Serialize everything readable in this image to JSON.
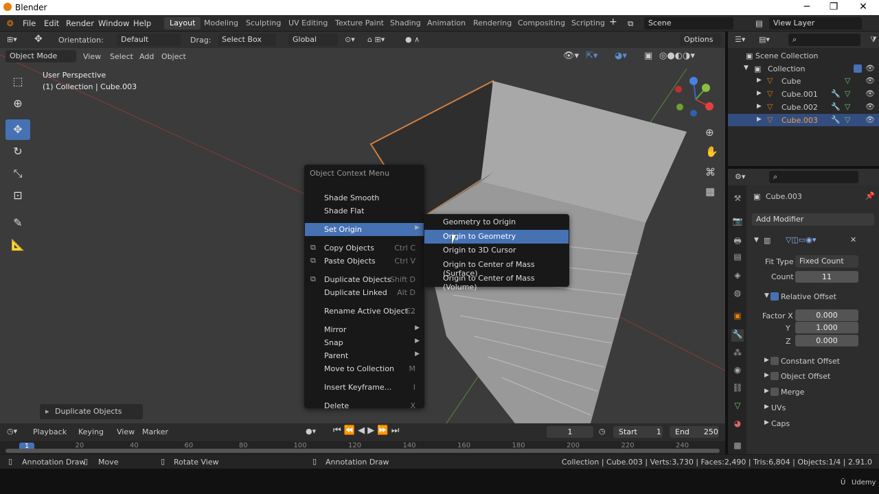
{
  "titlebar": {
    "title": "Blender",
    "min": "─",
    "max": "❐",
    "close": "✕"
  },
  "menu": [
    "File",
    "Edit",
    "Render",
    "Window",
    "Help"
  ],
  "workspaces": [
    "Layout",
    "Modeling",
    "Sculpting",
    "UV Editing",
    "Texture Paint",
    "Shading",
    "Animation",
    "Rendering",
    "Compositing",
    "Scripting"
  ],
  "active_workspace": "Layout",
  "scene": "Scene",
  "view_layer": "View Layer",
  "tool_header": {
    "orientation_label": "Orientation:",
    "orientation_value": "Default",
    "drag_label": "Drag:",
    "drag_value": "Select Box",
    "transform": "Global",
    "options": "Options"
  },
  "viewport_header": {
    "mode": "Object Mode",
    "view": "View",
    "select": "Select",
    "add": "Add",
    "object": "Object"
  },
  "viewport": {
    "perspective": "User Perspective",
    "context": "(1) Collection | Cube.003"
  },
  "context_menu": {
    "title": "Object Context Menu",
    "items": [
      {
        "label": "Shade Smooth",
        "shortcut": ""
      },
      {
        "label": "Shade Flat",
        "shortcut": ""
      },
      {
        "label": "Set Origin",
        "shortcut": "",
        "submenu": true,
        "selected": true
      },
      {
        "label": "Copy Objects",
        "shortcut": "Ctrl C"
      },
      {
        "label": "Paste Objects",
        "shortcut": "Ctrl V"
      },
      {
        "label": "Duplicate Objects",
        "shortcut": "Shift D"
      },
      {
        "label": "Duplicate Linked",
        "shortcut": "Alt D"
      },
      {
        "label": "Rename Active Object...",
        "shortcut": "F2"
      },
      {
        "label": "Mirror",
        "submenu": true
      },
      {
        "label": "Snap",
        "submenu": true
      },
      {
        "label": "Parent",
        "submenu": true
      },
      {
        "label": "Move to Collection",
        "shortcut": "M"
      },
      {
        "label": "Insert Keyframe...",
        "shortcut": "I"
      },
      {
        "label": "Delete",
        "shortcut": "X"
      }
    ]
  },
  "submenu": {
    "items": [
      "Geometry to Origin",
      "Origin to Geometry",
      "Origin to 3D Cursor",
      "Origin to Center of Mass (Surface)",
      "Origin to Center of Mass (Volume)"
    ],
    "selected": "Origin to Geometry"
  },
  "last_op": "Duplicate Objects",
  "outliner": {
    "scene_collection": "Scene Collection",
    "collection": "Collection",
    "objects": [
      "Cube",
      "Cube.001",
      "Cube.002",
      "Cube.003"
    ],
    "selected": "Cube.003"
  },
  "properties": {
    "object": "Cube.003",
    "add_modifier": "Add Modifier",
    "fit_type_label": "Fit Type",
    "fit_type": "Fixed Count",
    "count_label": "Count",
    "count": "11",
    "relative_offset": "Relative Offset",
    "factor_x_label": "Factor X",
    "factor_x": "0.000",
    "y_label": "Y",
    "factor_y": "1.000",
    "z_label": "Z",
    "factor_z": "0.000",
    "constant_offset": "Constant Offset",
    "object_offset": "Object Offset",
    "merge": "Merge",
    "uvs": "UVs",
    "caps": "Caps"
  },
  "timeline": {
    "playback": "Playback",
    "keying": "Keying",
    "view": "View",
    "marker": "Marker",
    "frame": "1",
    "start_label": "Start",
    "start": "1",
    "end_label": "End",
    "end": "250",
    "ticks": [
      "1",
      "20",
      "40",
      "60",
      "80",
      "100",
      "120",
      "140",
      "160",
      "180",
      "200",
      "220",
      "240"
    ]
  },
  "statusbar": {
    "left1": "Annotation Draw",
    "left2": "Move",
    "left3": "Rotate View",
    "left4": "Annotation Draw",
    "info": "Collection | Cube.003 | Verts:3,730 | Faces:2,490 | Tris:6,804 | Objects:1/4 | 2.91.0"
  },
  "watermark": "Udemy",
  "colors": {
    "accent": "#4672b4",
    "orange": "#e87d0d"
  }
}
